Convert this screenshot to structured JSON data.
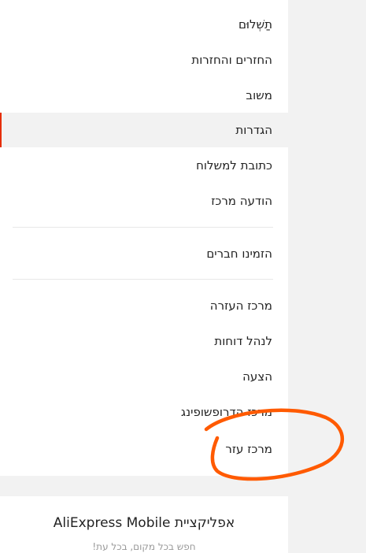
{
  "menu": {
    "items": [
      {
        "label": "תַשְׁלוּם"
      },
      {
        "label": "החזרים והחזרות"
      },
      {
        "label": "משוב"
      },
      {
        "label": "הגדרות"
      },
      {
        "label": "כתובת למשלוח"
      },
      {
        "label": "הודעה מרכז"
      },
      {
        "label": "הזמינו חברים"
      },
      {
        "label": "מרכז העזרה"
      },
      {
        "label": "לנהל דוחות"
      },
      {
        "label": "הצעה"
      },
      {
        "label": "מרכז הדרופשופינג"
      },
      {
        "label": "מרכז עזר"
      }
    ],
    "active_index": 3
  },
  "app_promo": {
    "title": "אפליקציית AliExpress Mobile",
    "subtitle": "חפש בכל מקום, בכל עת!"
  },
  "colors": {
    "accent": "#e62e04",
    "annotation": "#ff5a00",
    "text": "#222222",
    "page_bg": "#f2f2f2"
  }
}
